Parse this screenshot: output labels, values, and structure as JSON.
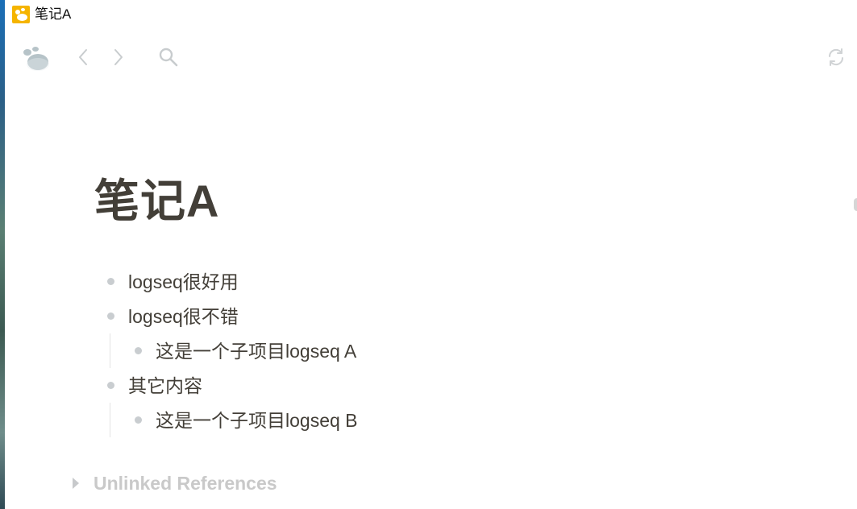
{
  "window": {
    "title": "笔记A"
  },
  "toolbar": {
    "logo_icon": "logseq-logo-icon",
    "back_icon": "chevron-left-icon",
    "forward_icon": "chevron-right-icon",
    "search_icon": "search-icon",
    "sync_icon": "sync-icon"
  },
  "page": {
    "title": "笔记A",
    "blocks": [
      {
        "text": "logseq很好用",
        "children": []
      },
      {
        "text": "logseq很不错",
        "children": [
          {
            "text": "这是一个子项目logseq A"
          }
        ]
      },
      {
        "text": "其它内容",
        "children": [
          {
            "text": "这是一个子项目logseq B"
          }
        ]
      }
    ]
  },
  "references": {
    "unlinked_label": "Unlinked References"
  },
  "colors": {
    "app_icon": "#f5b400",
    "text": "#433f38",
    "bullet": "#c9cdd0",
    "muted": "#c9c9c9"
  }
}
